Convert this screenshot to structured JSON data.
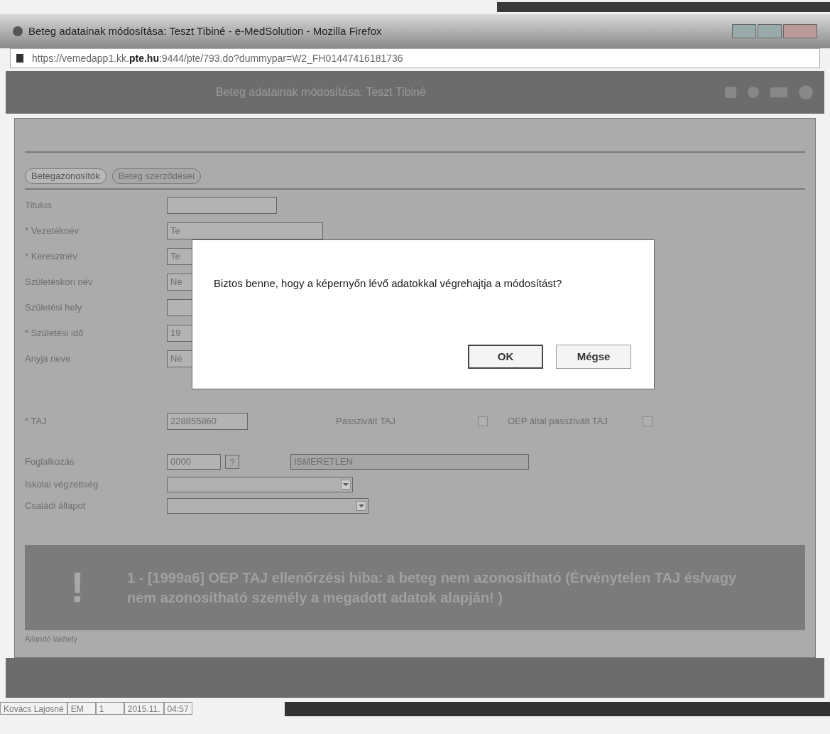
{
  "window": {
    "title": "Beteg adatainak módosítása: Teszt Tibiné - e-MedSolution - Mozilla Firefox",
    "url_prefix": "https://vemedapp1.kk.",
    "url_domain": "pte.hu",
    "url_rest": ":9444/pte/793.do?dummypar=W2_FH01447416181736"
  },
  "app_header": {
    "title": "Beteg adatainak módosítása: Teszt Tibiné"
  },
  "tabs": [
    {
      "label": "Betegazonosítók",
      "selected": true
    },
    {
      "label": "Beteg szerződései",
      "selected": false
    }
  ],
  "fields": [
    {
      "label": "Titulus",
      "kind": "text"
    },
    {
      "label": "* Vezetéknév",
      "value": "Te",
      "kind": "text"
    },
    {
      "label": "* Keresztnév",
      "value": "Te",
      "kind": "text"
    },
    {
      "label": "Születéskori név",
      "value": "Né",
      "kind": "text"
    },
    {
      "label": "Születési hely",
      "kind": "text"
    },
    {
      "label": "* Születési idő",
      "value": "19",
      "kind": "text"
    },
    {
      "label": "Anyja neve",
      "value": "Né",
      "kind": "text"
    }
  ],
  "taj": {
    "label": "* TAJ",
    "value": "228855860",
    "passive_label": "Passzivált TAJ",
    "passive_checked": false,
    "oep_label": "OEP által passzivált TAJ",
    "oep_checked": false
  },
  "occupation": {
    "label": "Foglalkozás",
    "code": "0000",
    "help": "?",
    "name": "ISMERETLEN"
  },
  "selects": [
    {
      "label": "Iskolai végzettség"
    },
    {
      "label": "Családi állapot"
    }
  ],
  "error": {
    "icon": "!",
    "message": "1 - [1999a6] OEP TAJ ellenőrzési hiba: a beteg nem azonosítható (Érvénytelen TAJ és/vagy nem azonosítható személy a megadott adatok alapján! )"
  },
  "section_label": "Állandó lakhely",
  "dialog": {
    "message": "Biztos benne, hogy a képernyőn lévő adatokkal végrehajtja a módosítást?",
    "buttons": [
      {
        "label": "OK",
        "selected": true
      },
      {
        "label": "Mégse",
        "selected": false
      }
    ]
  },
  "background_row": [
    "Kovács Lajosné",
    "EM",
    "1",
    "2015.11.",
    "04:57"
  ]
}
